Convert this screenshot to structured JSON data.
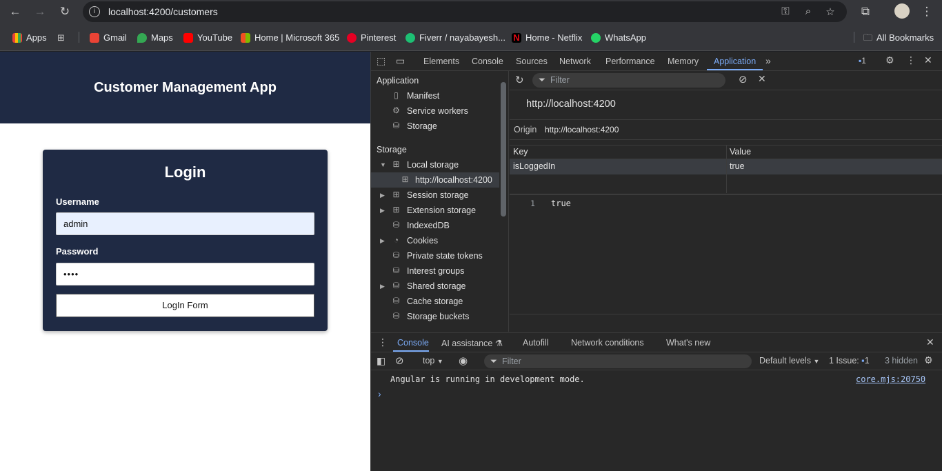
{
  "browser": {
    "url": "localhost:4200/customers",
    "bookmarks": [
      {
        "label": "Apps",
        "icon": "apps-grid-icon"
      },
      {
        "label": "Gmail",
        "icon": "gmail-icon"
      },
      {
        "label": "Maps",
        "icon": "maps-icon"
      },
      {
        "label": "YouTube",
        "icon": "youtube-icon"
      },
      {
        "label": "Home | Microsoft 365",
        "icon": "microsoft-icon"
      },
      {
        "label": "Pinterest",
        "icon": "pinterest-icon"
      },
      {
        "label": "Fiverr / nayabayesh...",
        "icon": "fiverr-icon"
      },
      {
        "label": "Home - Netflix",
        "icon": "netflix-icon"
      },
      {
        "label": "WhatsApp",
        "icon": "whatsapp-icon"
      }
    ],
    "all_bookmarks": "All Bookmarks"
  },
  "app": {
    "title": "Customer Management App",
    "login": {
      "heading": "Login",
      "username_label": "Username",
      "username_value": "admin",
      "password_label": "Password",
      "password_value": "••••",
      "submit_label": "LogIn Form"
    }
  },
  "devtools": {
    "tabs": [
      "Elements",
      "Console",
      "Sources",
      "Network",
      "Performance",
      "Memory",
      "Application"
    ],
    "active_tab": "Application",
    "issues_count": "1",
    "sidebar": {
      "application_heading": "Application",
      "application_items": [
        "Manifest",
        "Service workers",
        "Storage"
      ],
      "storage_heading": "Storage",
      "storage_items": [
        {
          "label": "Local storage",
          "expanded": true
        },
        {
          "label": "http://localhost:4200",
          "selected": true
        },
        {
          "label": "Session storage",
          "expanded": false
        },
        {
          "label": "Extension storage",
          "expanded": false
        },
        {
          "label": "IndexedDB"
        },
        {
          "label": "Cookies",
          "expanded": false
        },
        {
          "label": "Private state tokens"
        },
        {
          "label": "Interest groups"
        },
        {
          "label": "Shared storage",
          "expanded": false
        },
        {
          "label": "Cache storage"
        },
        {
          "label": "Storage buckets"
        }
      ]
    },
    "main": {
      "filter_placeholder": "Filter",
      "origin_title": "http://localhost:4200",
      "origin_label": "Origin",
      "origin_value": "http://localhost:4200",
      "columns": [
        "Key",
        "Value"
      ],
      "rows": [
        {
          "key": "isLoggedIn",
          "value": "true"
        }
      ],
      "preview_line_number": "1",
      "preview_value": "true"
    },
    "drawer": {
      "tabs": [
        "Console",
        "AI assistance",
        "Autofill",
        "Network conditions",
        "What's new"
      ],
      "active_tab": "Console",
      "context": "top",
      "filter_placeholder": "Filter",
      "levels": "Default levels",
      "issues_label": "1 Issue:",
      "issues_count": "1",
      "hidden": "3 hidden",
      "message": "Angular is running in development mode.",
      "source": "core.mjs:20750"
    }
  }
}
